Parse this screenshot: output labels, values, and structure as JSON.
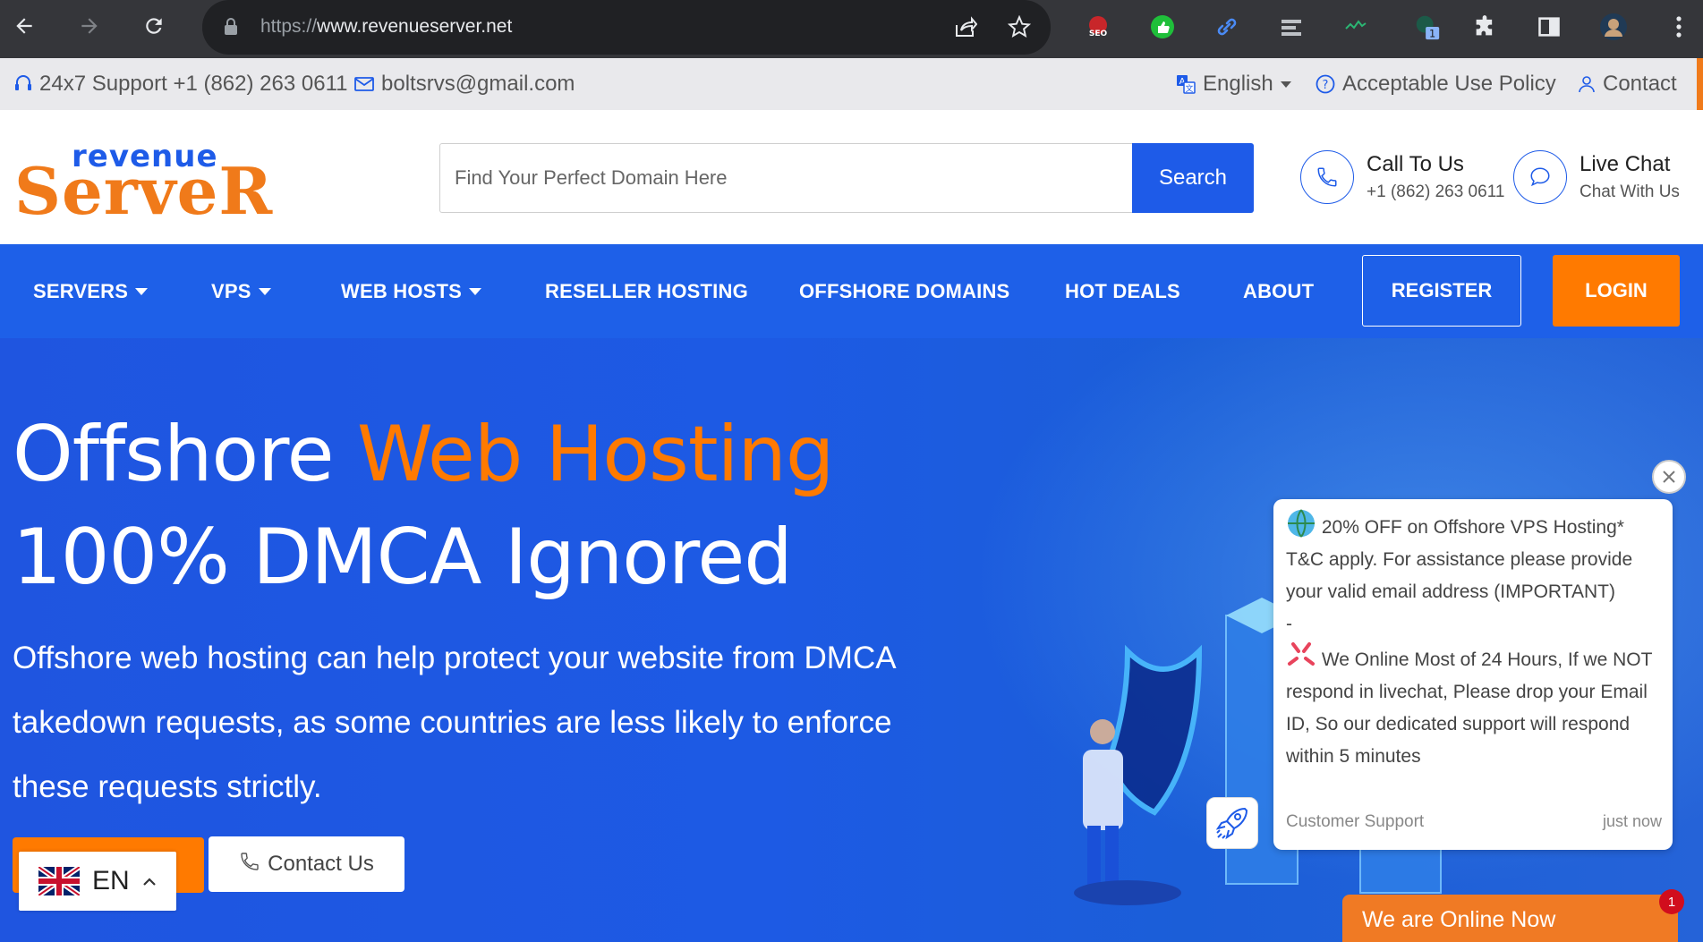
{
  "browser": {
    "url_scheme": "https://",
    "url_host": "www.revenueserver.net",
    "extension_badge": "1"
  },
  "topbar": {
    "support": "24x7 Support +1 (862) 263 0611",
    "email": "boltsrvs@gmail.com",
    "language": "English",
    "policy": "Acceptable Use Policy",
    "contact": "Contact"
  },
  "logo": {
    "top": "revenue",
    "bottom": "ServeR"
  },
  "search": {
    "placeholder": "Find Your Perfect Domain Here",
    "button": "Search"
  },
  "call": {
    "title": "Call To Us",
    "sub": "+1 (862) 263 0611"
  },
  "livechat": {
    "title": "Live Chat",
    "sub": "Chat With Us"
  },
  "nav": {
    "items": [
      "SERVERS",
      "VPS",
      "WEB HOSTS",
      "RESELLER HOSTING",
      "OFFSHORE DOMAINS",
      "HOT DEALS",
      "ABOUT"
    ],
    "register": "REGISTER",
    "login": "LOGIN"
  },
  "hero": {
    "title_part1": "Offshore ",
    "title_accent": "Web Hosting",
    "title_line2": "100% DMCA Ignored",
    "paragraph": "Offshore web hosting can help protect your website from DMCA takedown requests, as some countries are less likely to enforce these requests strictly.",
    "contact_button": "Contact Us"
  },
  "language_switcher": {
    "code": "EN"
  },
  "chat": {
    "line1": "20% OFF on Offshore VPS Hosting* T&C apply. For assistance please provide your valid email address (IMPORTANT)",
    "dash": "-",
    "line2": "We Online Most of 24 Hours, If we NOT respond in livechat, Please drop your Email ID, So our dedicated support will respond within 5 minutes",
    "sender": "Customer Support",
    "time": "just now",
    "online_label": "We are Online Now",
    "unread": "1"
  },
  "colors": {
    "brand_blue": "#1e5be8",
    "brand_orange": "#ff7a00",
    "logo_orange": "#f07a1a"
  }
}
